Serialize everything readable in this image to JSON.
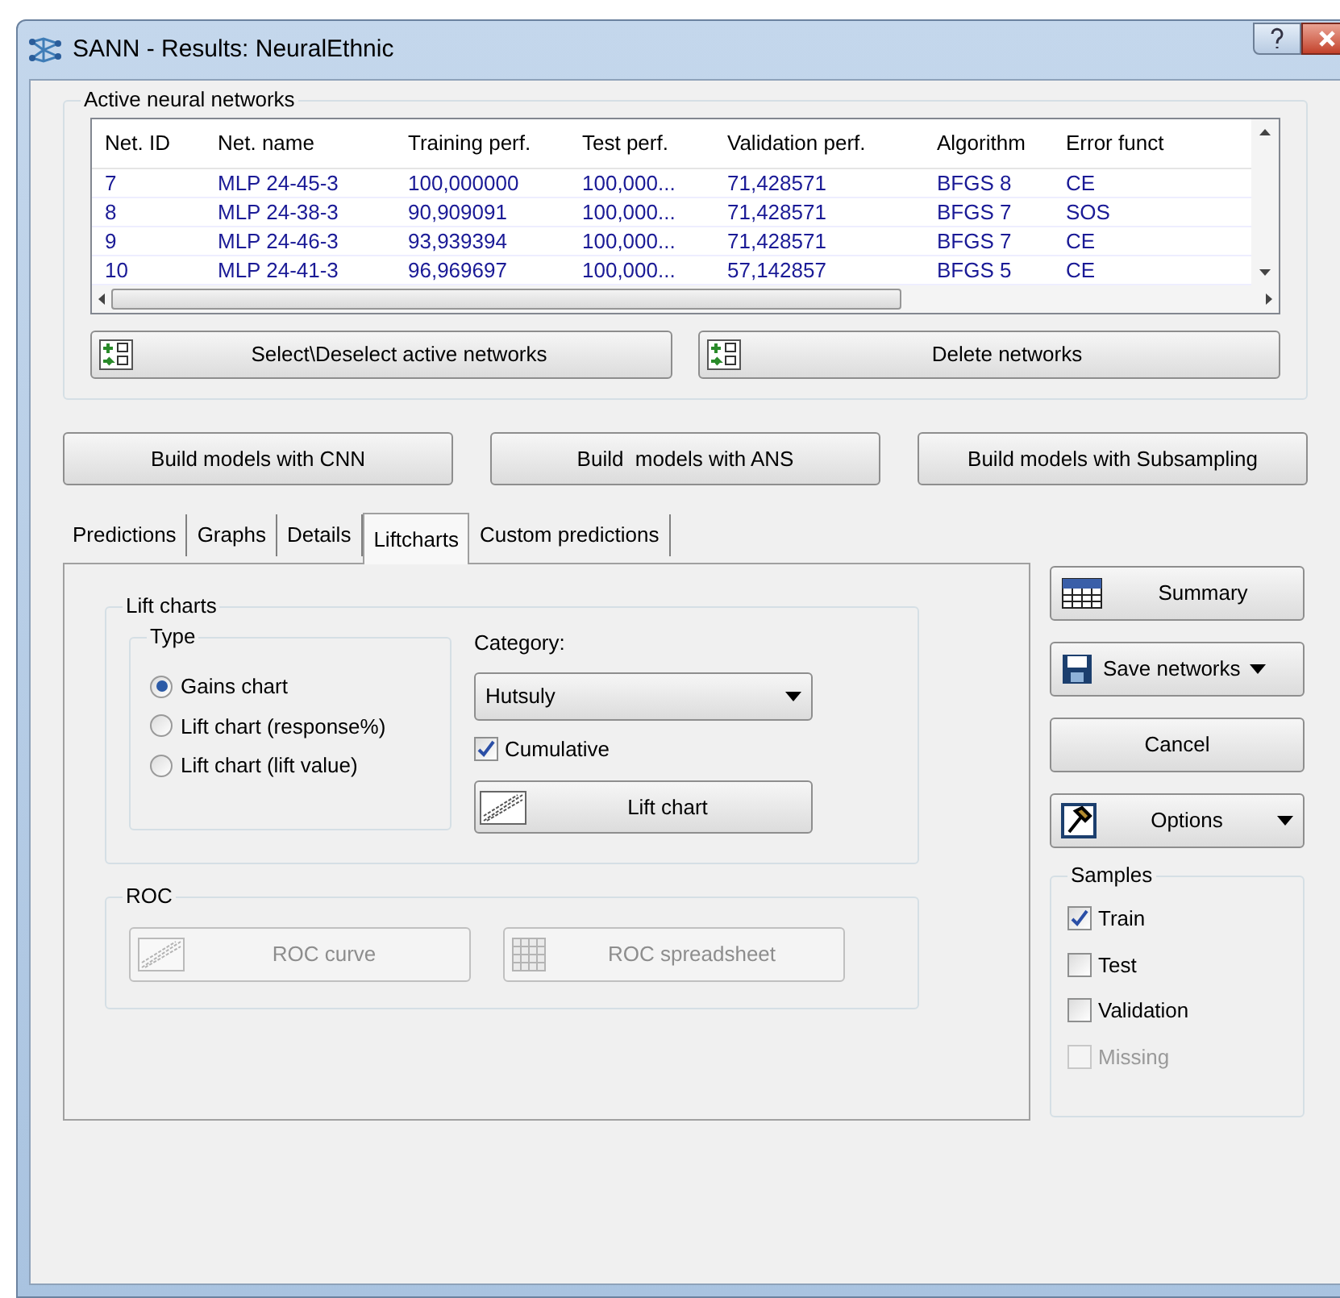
{
  "window": {
    "title": "SANN - Results: NeuralEthnic"
  },
  "networks": {
    "title": "Active neural networks",
    "columns": [
      "Net. ID",
      "Net. name",
      "Training perf.",
      "Test perf.",
      "Validation perf.",
      "Algorithm",
      "Error funct"
    ],
    "rows": [
      [
        "7",
        "MLP 24-45-3",
        "100,000000",
        "100,000...",
        "71,428571",
        "BFGS 8",
        "CE"
      ],
      [
        "8",
        "MLP 24-38-3",
        "90,909091",
        "100,000...",
        "71,428571",
        "BFGS 7",
        "SOS"
      ],
      [
        "9",
        "MLP 24-46-3",
        "93,939394",
        "100,000...",
        "71,428571",
        "BFGS 7",
        "CE"
      ],
      [
        "10",
        "MLP 24-41-3",
        "96,969697",
        "100,000...",
        "57,142857",
        "BFGS 5",
        "CE"
      ]
    ],
    "buttons": [
      "Select\\Deselect active networks",
      "Delete networks"
    ]
  },
  "build_buttons": [
    "Build models with CNN",
    "Build  models with ANS",
    "Build models with Subsampling"
  ],
  "tabs": [
    {
      "label": "Predictions",
      "selected": false
    },
    {
      "label": "Graphs",
      "selected": false
    },
    {
      "label": "Details",
      "selected": false
    },
    {
      "label": "Liftcharts",
      "selected": true
    },
    {
      "label": "Custom predictions",
      "selected": false
    }
  ],
  "lift_charts": {
    "title": "Lift charts",
    "type": {
      "title": "Type",
      "options": [
        {
          "label": "Gains chart",
          "selected": true
        },
        {
          "label": "Lift chart (response%)",
          "selected": false
        },
        {
          "label": "Lift chart (lift value)",
          "selected": false
        }
      ]
    },
    "category": {
      "label": "Category:",
      "value": "Hutsuly"
    },
    "cumulative": {
      "label": "Cumulative",
      "checked": true
    },
    "button": "Lift chart"
  },
  "roc": {
    "title": "ROC",
    "buttons": [
      {
        "label": "ROC curve",
        "kind": "chart",
        "disabled": true
      },
      {
        "label": "ROC spreadsheet",
        "kind": "grid",
        "disabled": true
      }
    ]
  },
  "side_buttons": [
    {
      "label": "Summary",
      "kind": "table"
    },
    {
      "label": "Save networks",
      "kind": "save"
    },
    {
      "label": "Cancel",
      "kind": "plain"
    },
    {
      "label": "Options",
      "kind": "tool"
    }
  ],
  "samples": {
    "title": "Samples",
    "items": [
      {
        "label": "Train",
        "checked": true,
        "disabled": false
      },
      {
        "label": "Test",
        "checked": false,
        "disabled": false
      },
      {
        "label": "Validation",
        "checked": false,
        "disabled": false
      },
      {
        "label": "Missing",
        "checked": false,
        "disabled": true
      }
    ]
  }
}
